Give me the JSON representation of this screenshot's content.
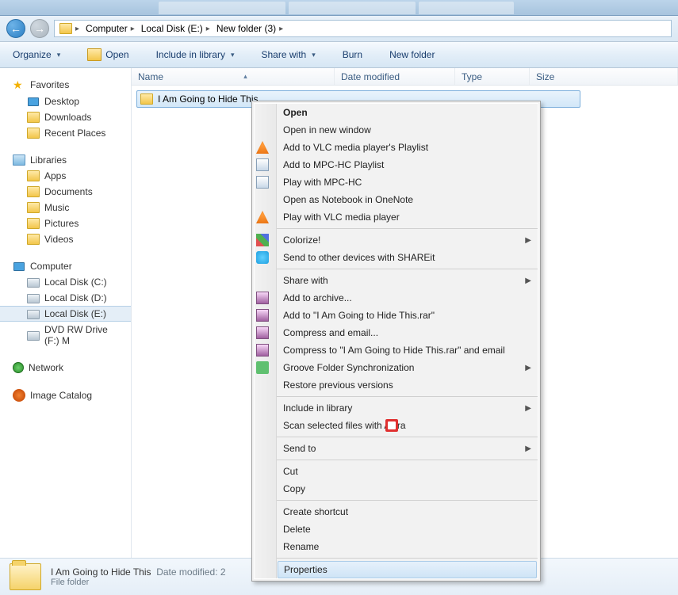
{
  "titlebar_tabs": [
    "",
    "",
    ""
  ],
  "breadcrumb": [
    "Computer",
    "Local Disk (E:)",
    "New folder (3)"
  ],
  "toolbar": {
    "organize": "Organize",
    "open": "Open",
    "include": "Include in library",
    "share": "Share with",
    "burn": "Burn",
    "newfolder": "New folder"
  },
  "sidebar": {
    "favorites": {
      "label": "Favorites",
      "items": [
        "Desktop",
        "Downloads",
        "Recent Places"
      ]
    },
    "libraries": {
      "label": "Libraries",
      "items": [
        "Apps",
        "Documents",
        "Music",
        "Pictures",
        "Videos"
      ]
    },
    "computer": {
      "label": "Computer",
      "items": [
        "Local Disk (C:)",
        "Local Disk (D:)",
        "Local Disk (E:)",
        "DVD RW Drive (F:)  M"
      ]
    },
    "network": {
      "label": "Network"
    },
    "imagecatalog": {
      "label": "Image Catalog"
    }
  },
  "columns": {
    "name": "Name",
    "date": "Date modified",
    "type": "Type",
    "size": "Size"
  },
  "files": [
    {
      "name": "I Am Going to Hide This"
    }
  ],
  "status": {
    "title": "I Am Going to Hide This",
    "meta_label": "Date modified:",
    "meta_value": "2",
    "type": "File folder"
  },
  "context_menu": [
    {
      "label": "Open",
      "bold": true
    },
    {
      "label": "Open in new window"
    },
    {
      "label": "Add to VLC media player's Playlist",
      "icon": "vlc"
    },
    {
      "label": "Add to MPC-HC Playlist",
      "icon": "mpc"
    },
    {
      "label": "Play with MPC-HC",
      "icon": "mpc"
    },
    {
      "label": "Open as Notebook in OneNote"
    },
    {
      "label": "Play with VLC media player",
      "icon": "vlc"
    },
    {
      "sep": true
    },
    {
      "label": "Colorize!",
      "icon": "color-sq",
      "submenu": true
    },
    {
      "label": "Send to other devices with SHAREit",
      "icon": "share"
    },
    {
      "sep": true
    },
    {
      "label": "Share with",
      "submenu": true
    },
    {
      "label": "Add to archive...",
      "icon": "rar"
    },
    {
      "label": "Add to \"I Am Going to Hide This.rar\"",
      "icon": "rar"
    },
    {
      "label": "Compress and email...",
      "icon": "rar"
    },
    {
      "label": "Compress to \"I Am Going to Hide This.rar\" and email",
      "icon": "rar"
    },
    {
      "label": "Groove Folder Synchronization",
      "icon": "groove",
      "submenu": true
    },
    {
      "label": "Restore previous versions"
    },
    {
      "sep": true
    },
    {
      "label": "Include in library",
      "submenu": true
    },
    {
      "label": "Scan selected files with Avira",
      "icon": "avira"
    },
    {
      "sep": true
    },
    {
      "label": "Send to",
      "submenu": true
    },
    {
      "sep": true
    },
    {
      "label": "Cut"
    },
    {
      "label": "Copy"
    },
    {
      "sep": true
    },
    {
      "label": "Create shortcut"
    },
    {
      "label": "Delete"
    },
    {
      "label": "Rename"
    },
    {
      "sep": true
    },
    {
      "label": "Properties",
      "hover": true
    }
  ]
}
